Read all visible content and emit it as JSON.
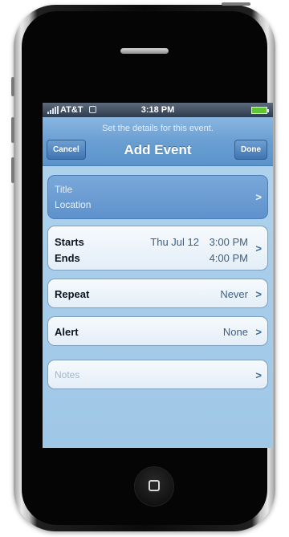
{
  "status_bar": {
    "carrier": "AT&T",
    "time": "3:18 PM"
  },
  "nav": {
    "prompt": "Set the details for this event.",
    "title": "Add Event",
    "cancel_label": "Cancel",
    "done_label": "Done"
  },
  "title_card": {
    "title_placeholder": "Title",
    "location_placeholder": "Location"
  },
  "dates": {
    "starts_label": "Starts",
    "ends_label": "Ends",
    "start_date": "Thu Jul 12",
    "start_time": "3:00 PM",
    "end_time": "4:00 PM"
  },
  "repeat": {
    "label": "Repeat",
    "value": "Never"
  },
  "alert": {
    "label": "Alert",
    "value": "None"
  },
  "notes": {
    "placeholder": "Notes"
  },
  "icons": {
    "chevron": "chevron-right-icon",
    "signal": "signal-icon",
    "wifi": "wifi-icon",
    "battery": "battery-icon",
    "home": "home-button-icon"
  },
  "colors": {
    "nav": "#6a9fd3",
    "screen_bg": "#a7cdea",
    "battery": "#61c531"
  }
}
